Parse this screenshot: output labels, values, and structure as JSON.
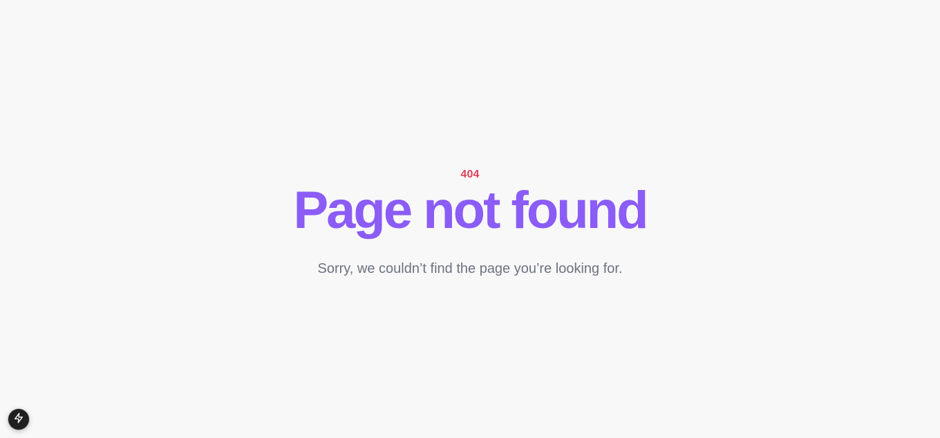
{
  "error": {
    "code": "404",
    "title": "Page not found",
    "message": "Sorry, we couldn’t find the page you’re looking for."
  },
  "dev_indicator": {
    "icon": "lightning-bolt-icon"
  },
  "colors": {
    "background": "#f8f8f8",
    "code": "#e0405a",
    "title": "#8b5cf6",
    "message": "#6b7280"
  }
}
